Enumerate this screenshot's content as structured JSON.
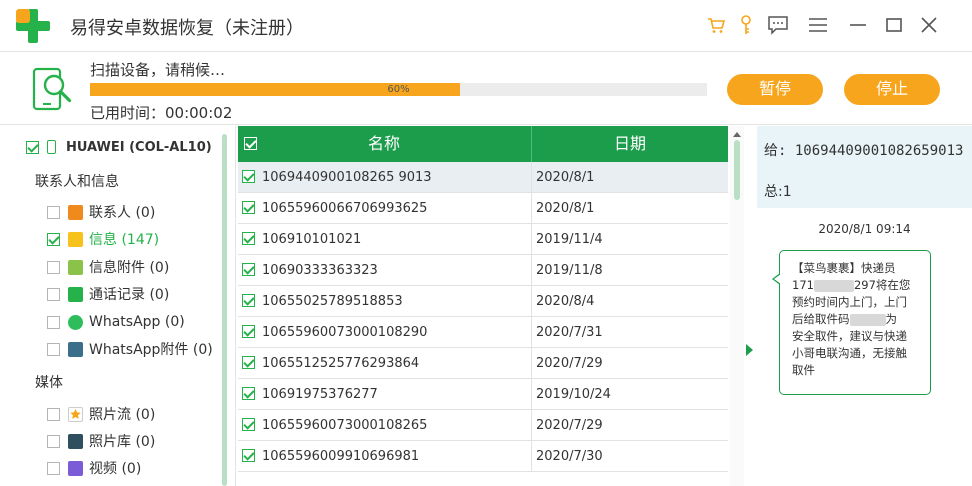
{
  "app": {
    "title": "易得安卓数据恢复（未注册）",
    "colors": {
      "brand_green": "#26b24a",
      "header_green": "#1c9d4c",
      "accent_orange": "#f7a51c"
    },
    "titlebar_icons": [
      "cart-icon",
      "key-icon",
      "feedback-icon",
      "menu-icon",
      "minimize-icon",
      "maximize-icon",
      "close-icon"
    ]
  },
  "scan": {
    "status": "扫描设备，请稍候…",
    "progress": 0.6,
    "progress_label": "60%",
    "elapsed": "已用时间：00:00:02",
    "pause_label": "暂停",
    "stop_label": "停止"
  },
  "sidebar": {
    "device": "HUAWEI (COL-AL10)",
    "section_contacts": "联系人和信息",
    "section_media": "媒体",
    "categories": [
      {
        "label": "联系人 (0)",
        "icon": "contacts-icon",
        "checked": false,
        "active": false
      },
      {
        "label": "信息 (147)",
        "icon": "message-icon",
        "checked": true,
        "active": true
      },
      {
        "label": "信息附件 (0)",
        "icon": "attachment-icon",
        "checked": false,
        "active": false
      },
      {
        "label": "通话记录 (0)",
        "icon": "phone-icon",
        "checked": false,
        "active": false
      },
      {
        "label": "WhatsApp (0)",
        "icon": "whatsapp-icon",
        "checked": false,
        "active": false
      },
      {
        "label": "WhatsApp附件 (0)",
        "icon": "whatsapp-attachment-icon",
        "checked": false,
        "active": false
      },
      {
        "label": "照片流 (0)",
        "icon": "photostream-icon",
        "checked": false,
        "active": false
      },
      {
        "label": "照片库 (0)",
        "icon": "photolibrary-icon",
        "checked": false,
        "active": false
      },
      {
        "label": "视频 (0)",
        "icon": "video-icon",
        "checked": false,
        "active": false
      }
    ]
  },
  "table": {
    "col_name": "名称",
    "col_date": "日期",
    "rows": [
      {
        "name": "1069440900108265 9013",
        "date": "2020/8/1"
      },
      {
        "name": "10655960066706993625",
        "date": "2020/8/1"
      },
      {
        "name": "106910101021",
        "date": "2019/11/4"
      },
      {
        "name": "10690333363323",
        "date": "2019/11/8"
      },
      {
        "name": "10655025789518853",
        "date": "2020/8/4"
      },
      {
        "name": "10655960073000108290",
        "date": "2020/7/31"
      },
      {
        "name": "1065512525776293864",
        "date": "2020/7/29"
      },
      {
        "name": "10691975376277",
        "date": "2019/10/24"
      },
      {
        "name": "10655960073000108265",
        "date": "2020/7/29"
      },
      {
        "name": "1065596009910696981",
        "date": "2020/7/30"
      }
    ]
  },
  "detail": {
    "to": "给: 10694409001082659013",
    "total": "总:1",
    "time": "2020/8/1 09:14",
    "message": {
      "line1": "【菜鸟裹裹】快递员",
      "line2_prefix": "171",
      "line2_suffix": "297将在您",
      "line3": "预约时间内上门，上门",
      "line4_prefix": "后给取件码",
      "line4_suffix": "为",
      "line5": "安全取件，建议与快递",
      "line6": "小哥电联沟通，无接触",
      "line7": "取件"
    }
  }
}
